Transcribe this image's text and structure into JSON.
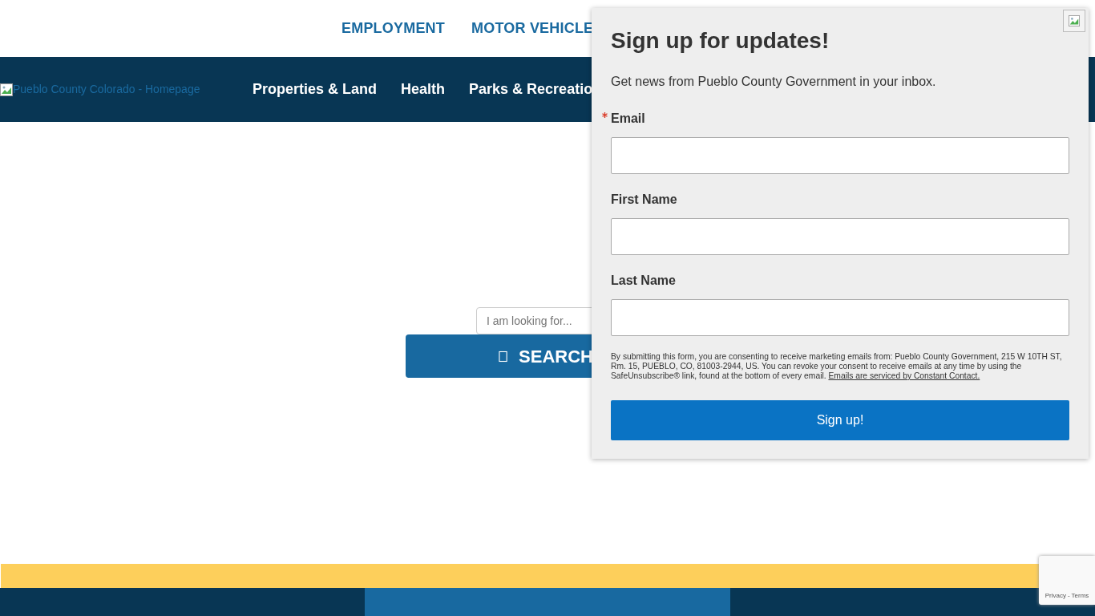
{
  "top_links": [
    "EMPLOYMENT",
    "MOTOR VEHICLE"
  ],
  "logo": {
    "alt_text": "Pueblo County Colorado - Homepage"
  },
  "nav": [
    "Properties & Land",
    "Health",
    "Parks & Recreatio"
  ],
  "search": {
    "placeholder": "I am looking for...",
    "button": "SEARCH"
  },
  "popup": {
    "title": "Sign up for updates!",
    "subtitle": "Get news from Pueblo County Government in your inbox.",
    "fields": [
      {
        "label": "Email",
        "required": true
      },
      {
        "label": "First Name",
        "required": false
      },
      {
        "label": "Last Name",
        "required": false
      }
    ],
    "consent": "By submitting this form, you are consenting to receive marketing emails from: Pueblo County Government, 215 W 10TH ST, Rm. 15, PUEBLO, CO, 81003-2944, US. You can revoke your consent to receive emails at any time by using the SafeUnsubscribe® link, found at the bottom of every email.",
    "consent_link": "Emails are serviced by Constant Contact.",
    "submit": "Sign up!"
  },
  "recaptcha": {
    "links": [
      "Privacy",
      "Terms"
    ],
    "separator": "-"
  }
}
